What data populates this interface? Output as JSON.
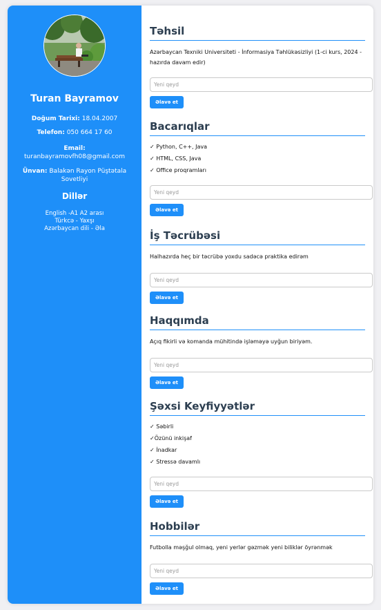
{
  "profile": {
    "name": "Turan Bayramov",
    "dob_label": "Doğum Tarixi:",
    "dob_value": "18.04.2007",
    "phone_label": "Telefon:",
    "phone_value": "050 664 17 60",
    "email_label": "Email:",
    "email_value": "turanbayramovfh08@gmail.com",
    "address_label": "Ünvan:",
    "address_value": "Balakən Rayon Püştətala Sovetliyi",
    "languages_title": "Dillər",
    "languages": [
      "English -A1 A2 arası",
      "Türkcə - Yaxşı",
      "Azərbaycan dili - Əla"
    ]
  },
  "sections": {
    "education": {
      "title": "Təhsil",
      "text": "Azərbaycan Texniki Universiteti - İnformasiya Təhlükəsizliyi (1-ci kurs, 2024 - hazırda davam edir)",
      "placeholder": "Yeni qeyd",
      "button": "Əlavə et"
    },
    "skills": {
      "title": "Bacarıqlar",
      "items": [
        "✓ Python, C++, Java",
        "✓ HTML, CSS, Java",
        "✓ Office proqramları"
      ],
      "placeholder": "Yeni qeyd",
      "button": "Əlavə et"
    },
    "experience": {
      "title": "İş Təcrübəsi",
      "text": "Halhazırda heç bir təcrübə yoxdu sadəcə praktika edirəm",
      "placeholder": "Yeni qeyd",
      "button": "Əlavə et"
    },
    "about": {
      "title": "Haqqımda",
      "text": "Açıq fikirli və komanda mühitində işləməyə uyğun biriyəm.",
      "placeholder": "Yeni qeyd",
      "button": "Əlavə et"
    },
    "qualities": {
      "title": "Şəxsi Keyfiyyətlər",
      "items": [
        "✓ Səbirli",
        "✓Özünü inkişaf",
        "✓ İnadkar",
        "✓ Stressə davamlı"
      ],
      "placeholder": "Yeni qeyd",
      "button": "Əlavə et"
    },
    "hobbies": {
      "title": "Hobbilər",
      "text": "Futbolla məşğul olmaq, yeni yerlər gəzmək yeni biliklər öyrənmək",
      "placeholder": "Yeni qeyd",
      "button": "Əlavə et"
    }
  }
}
